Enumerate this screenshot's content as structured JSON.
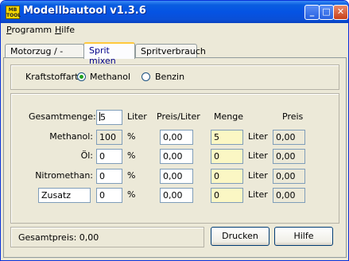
{
  "window": {
    "title": "Modellbautool v1.3.6",
    "icon_text": "MB TOOL"
  },
  "menu": [
    {
      "label": "Programm",
      "accel": "P",
      "rest": "rogramm"
    },
    {
      "label": "Hilfe",
      "accel": "H",
      "rest": "ilfe"
    }
  ],
  "tabs": [
    {
      "label": "Motorzug / -sturz"
    },
    {
      "label": "Sprit mixen",
      "active": true
    },
    {
      "label": "Spritverbrauch"
    }
  ],
  "fuel_type": {
    "label": "Kraftstoffart:",
    "options": [
      {
        "label": "Methanol",
        "selected": true
      },
      {
        "label": "Benzin",
        "selected": false
      }
    ]
  },
  "columns": {
    "price_per_liter": "Preis/Liter",
    "amount": "Menge",
    "price": "Preis"
  },
  "total": {
    "label": "Gesamtmenge:",
    "value": "5",
    "unit": "Liter"
  },
  "rows": [
    {
      "name": "Methanol:",
      "percent": "100",
      "percent_unit": "%",
      "price_per_liter": "0,00",
      "amount": "5",
      "amount_unit": "Liter",
      "price": "0,00"
    },
    {
      "name": "Öl:",
      "percent": "0",
      "percent_unit": "%",
      "price_per_liter": "0,00",
      "amount": "0",
      "amount_unit": "Liter",
      "price": "0,00"
    },
    {
      "name": "Nitromethan:",
      "percent": "0",
      "percent_unit": "%",
      "price_per_liter": "0,00",
      "amount": "0",
      "amount_unit": "Liter",
      "price": "0,00"
    },
    {
      "name": "Zusatz",
      "percent": "0",
      "percent_unit": "%",
      "price_per_liter": "0,00",
      "amount": "0",
      "amount_unit": "Liter",
      "price": "0,00"
    }
  ],
  "footer": {
    "total_price": "Gesamtpreis: 0,00",
    "print_button": "Drucken",
    "help_button": "Hilfe"
  },
  "colors": {
    "titlebar": "#0553e3",
    "amount_field_bg": "#fbf7c4",
    "active_tab_accent": "#ffc83c",
    "window_bg": "#ece9d8"
  }
}
